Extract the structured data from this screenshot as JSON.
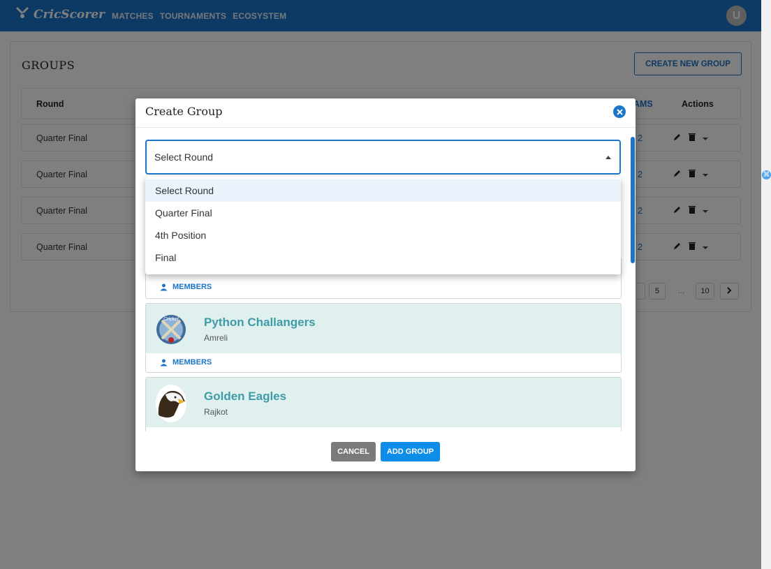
{
  "header": {
    "brand": "CricScorer",
    "nav": [
      "MATCHES",
      "TOURNAMENTS",
      "ECOSYSTEM"
    ],
    "avatar_initial": "U",
    "color": "#1b75c9"
  },
  "page": {
    "title": "GROUPS",
    "create_button": "CREATE NEW GROUP",
    "table": {
      "columns": [
        "Round",
        "TEAMS",
        "Actions"
      ],
      "rows": [
        {
          "round": "Quarter Final",
          "teams": "2"
        },
        {
          "round": "Quarter Final",
          "teams": "2"
        },
        {
          "round": "Quarter Final",
          "teams": "2"
        },
        {
          "round": "Quarter Final",
          "teams": "2"
        }
      ]
    },
    "pagination": [
      "5",
      "...",
      "10"
    ]
  },
  "modal": {
    "title": "Create Group",
    "select": {
      "value": "Select Round",
      "options": [
        "Select Round",
        "Quarter Final",
        "4th Position",
        "Final"
      ],
      "selected_index": 0
    },
    "members_label": "MEMBERS",
    "teams": [
      {
        "name": "Python Challangers",
        "city": "Amreli",
        "logo_icon": "cricket-logo-icon"
      },
      {
        "name": "Golden Eagles",
        "city": "Rajkot",
        "logo_icon": "eagle-logo-icon"
      }
    ],
    "cancel_label": "CANCEL",
    "add_label": "ADD GROUP"
  }
}
